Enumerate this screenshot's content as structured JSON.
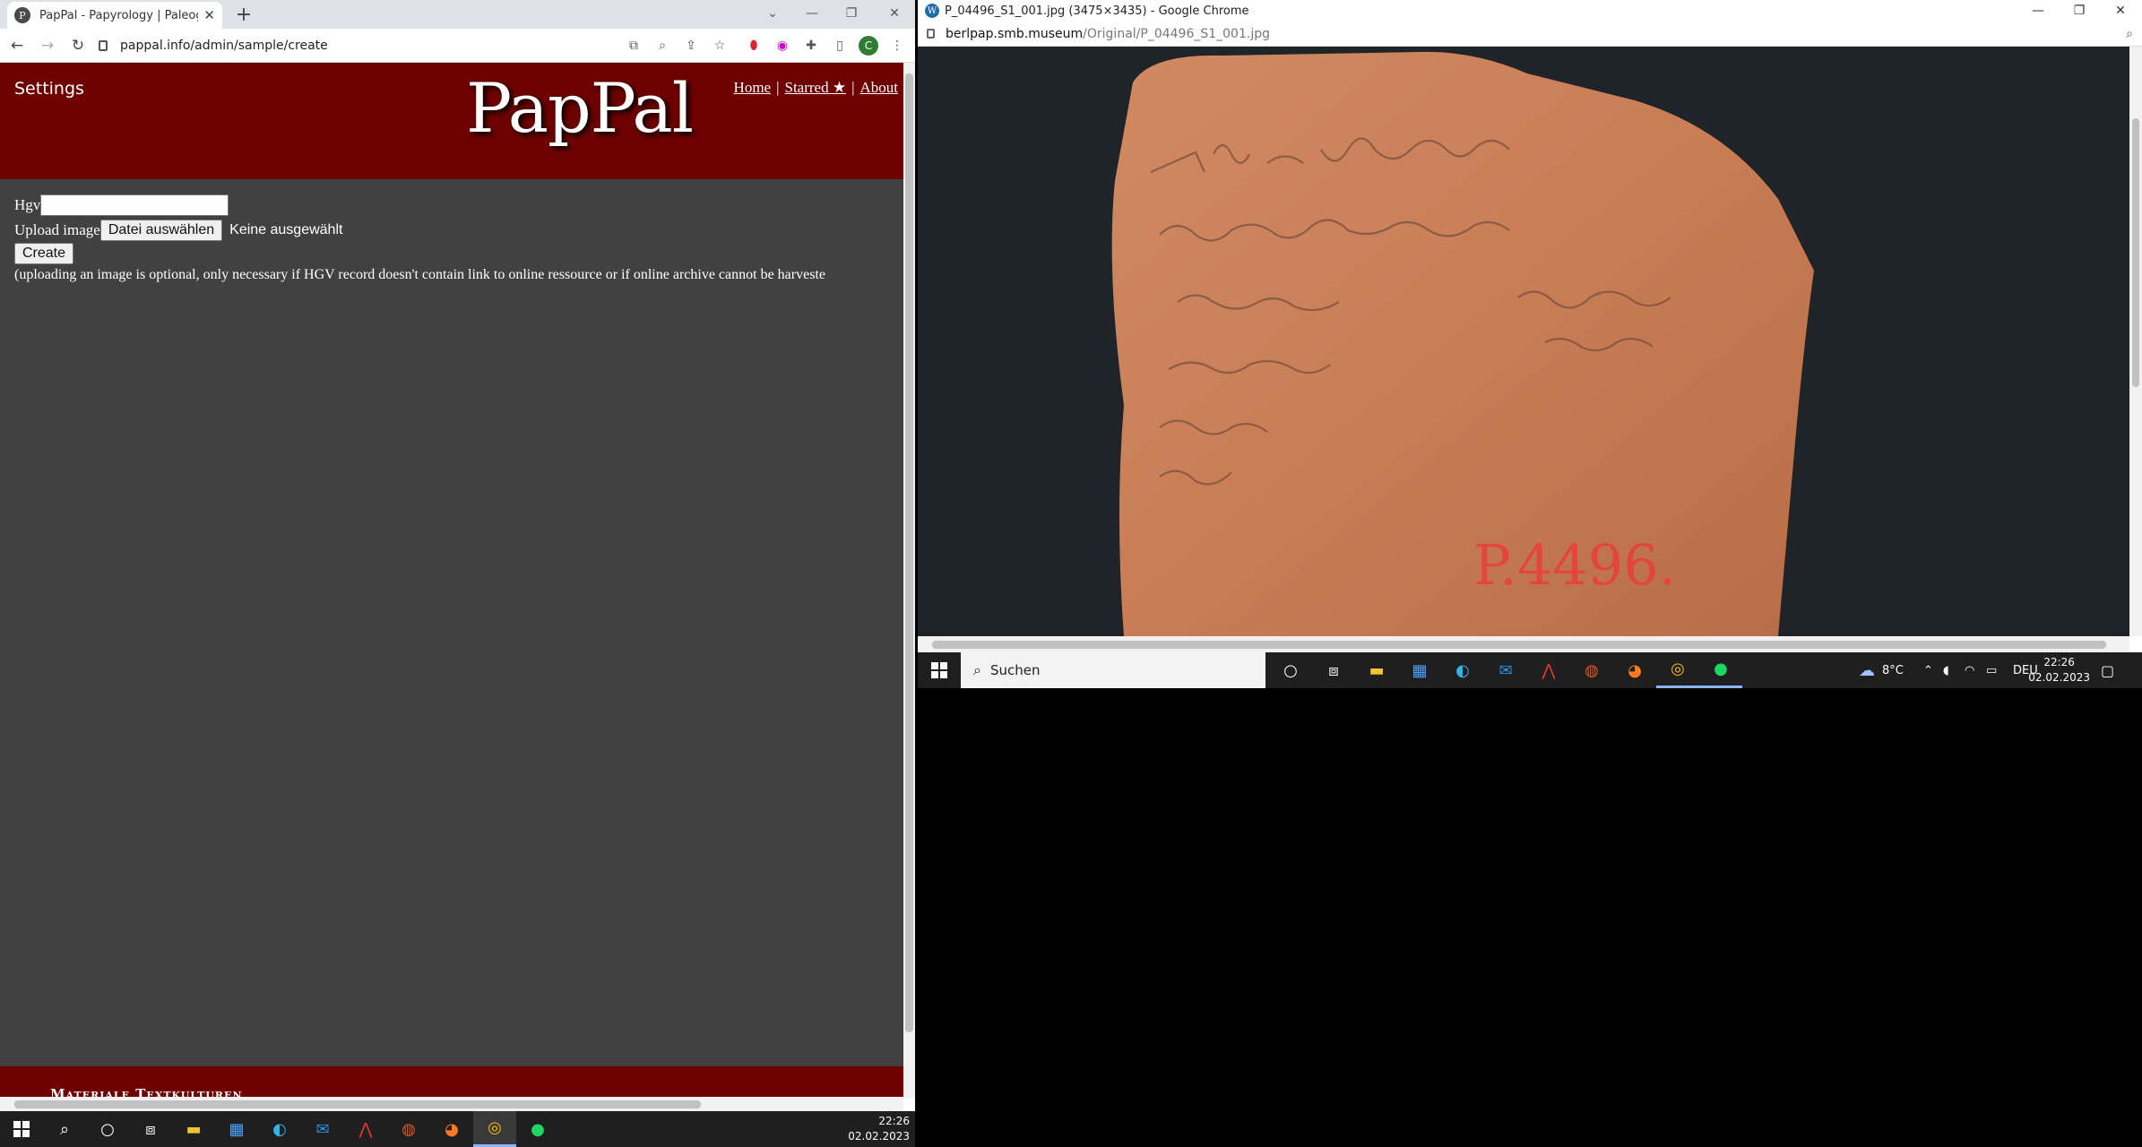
{
  "left_window": {
    "tab_title": "PapPal - Papyrology | Paleography",
    "url": "pappal.info/admin/sample/create",
    "profile_initial": "C"
  },
  "site": {
    "settings_label": "Settings",
    "logo": "PapPal",
    "nav": [
      {
        "label": "Home"
      },
      {
        "label": "Starred ★"
      },
      {
        "label": "About"
      }
    ],
    "nav_separator": "|",
    "form": {
      "hgv_label": "Hgv",
      "hgv_value": "",
      "upload_label": "Upload image",
      "file_button": "Datei auswählen",
      "file_status": "Keine ausgewählt",
      "create_button": "Create",
      "note": "(uploading an image is optional, only necessary if HGV record doesn't contain link to online ressource or if online archive cannot be harveste"
    },
    "footer_text": "Materiale Textkulturen"
  },
  "right_window": {
    "title": "P_04496_S1_001.jpg (3475×3435) - Google Chrome",
    "url_host": "berlpap.smb.museum",
    "url_path": "/Original/P_04496_S1_001.jpg",
    "sherd_label": "P.4496."
  },
  "taskbar": {
    "search_placeholder": "Suchen",
    "weather": "8°C",
    "language": "DEU",
    "time": "22:26",
    "date": "02.02.2023"
  },
  "colors": {
    "site_header": "#6e0000",
    "site_bg": "#414141",
    "taskbar": "#1f1f1f",
    "chrome_tabbar": "#dee1e6"
  }
}
